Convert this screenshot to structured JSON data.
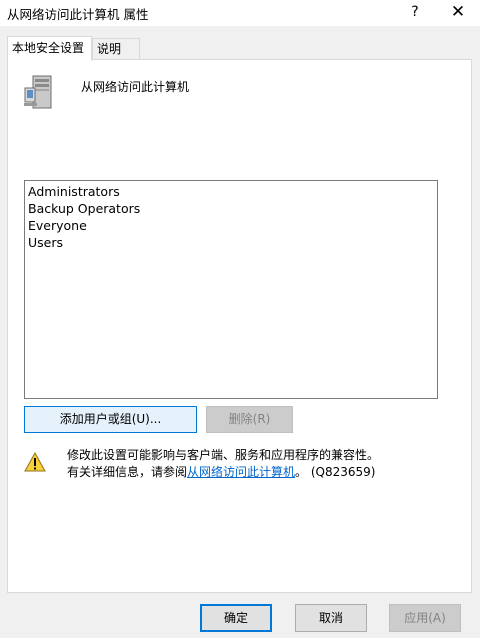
{
  "window": {
    "title": "从网络访问此计算机 属性",
    "help_glyph": "?",
    "close_glyph": "✕"
  },
  "tabs": [
    {
      "label": "本地安全设置",
      "active": true
    },
    {
      "label": "说明",
      "active": false
    }
  ],
  "policy": {
    "icon": "server-computer-icon",
    "name": "从网络访问此计算机"
  },
  "accounts": [
    "Administrators",
    "Backup Operators",
    "Everyone",
    "Users"
  ],
  "buttons": {
    "add": "添加用户或组(U)...",
    "remove": "删除(R)",
    "ok": "确定",
    "cancel": "取消",
    "apply": "应用(A)"
  },
  "warning": {
    "icon": "warning-icon",
    "line1": "修改此设置可能影响与客户端、服务和应用程序的兼容性。",
    "line2_prefix": "有关详细信息，请参阅",
    "link_text": "从网络访问此计算机",
    "line2_suffix": "。 (Q823659)"
  },
  "colors": {
    "accent": "#0078d7",
    "link": "#0066cc",
    "disabled_text": "#838383"
  }
}
